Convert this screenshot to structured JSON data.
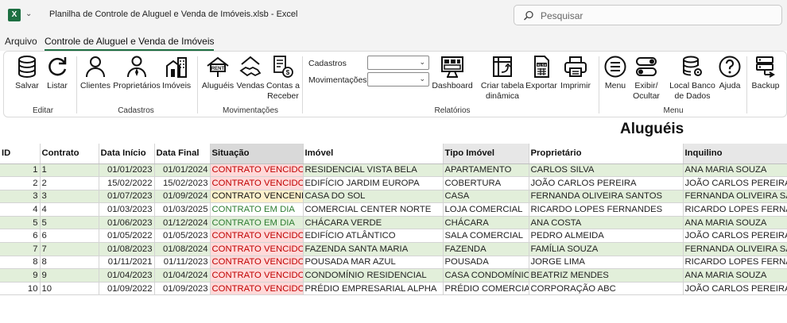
{
  "window": {
    "app_icon": "excel-icon",
    "title": "Planilha de Controle de Aluguel e Venda de Imóveis.xlsb  -  Excel",
    "search_placeholder": "Pesquisar"
  },
  "tabs": [
    "Arquivo",
    "Controle de Aluguel e Venda de Imóveis"
  ],
  "ribbon": {
    "groups": {
      "editar": "Editar",
      "cadastros": "Cadastros",
      "movimentacoes": "Movimentações",
      "relatorios": "Relatórios",
      "menu": "Menu"
    },
    "buttons": {
      "salvar": "Salvar",
      "listar": "Listar",
      "clientes": "Clientes",
      "proprietarios": "Proprietários",
      "imoveis": "Imóveis",
      "alugueis": "Aluguéis",
      "vendas": "Vendas",
      "contas_a_receber_1": "Contas a",
      "contas_a_receber_2": "Receber",
      "dashboard": "Dashboard",
      "criar_tabela_1": "Criar tabela",
      "criar_tabela_2": "dinâmica",
      "exportar": "Exportar",
      "imprimir": "Imprimir",
      "menu": "Menu",
      "exibir_1": "Exibir/",
      "exibir_2": "Ocultar",
      "local_banco_1": "Local Banco",
      "local_banco_2": "de Dados",
      "ajuda": "Ajuda",
      "backup": "Backup"
    },
    "fields": {
      "cadastros_label": "Cadastros",
      "movimentacoes_label": "Movimentações",
      "cadastros_value": "",
      "movimentacoes_value": ""
    }
  },
  "sheet": {
    "title": "Aluguéis",
    "columns": [
      "ID",
      "Contrato",
      "Data Início",
      "Data Final",
      "Situação",
      "Imóvel",
      "Tipo Imóvel",
      "Proprietário",
      "Inquilino"
    ],
    "rows": [
      {
        "id": "1",
        "contrato": "1",
        "inicio": "01/01/2023",
        "final": "01/01/2024",
        "situacao": "CONTRATO VENCIDO",
        "status": "venc",
        "imovel": "RESIDENCIAL VISTA BELA",
        "tipo": "APARTAMENTO",
        "proprietario": "CARLOS SILVA",
        "inquilino": "ANA MARIA SOUZA"
      },
      {
        "id": "2",
        "contrato": "2",
        "inicio": "15/02/2022",
        "final": "15/02/2023",
        "situacao": "CONTRATO VENCIDO",
        "status": "venc",
        "imovel": "EDIFÍCIO JARDIM EUROPA",
        "tipo": "COBERTURA",
        "proprietario": "JOÃO CARLOS PEREIRA",
        "inquilino": "JOÃO CARLOS PEREIRA"
      },
      {
        "id": "3",
        "contrato": "3",
        "inicio": "01/07/2023",
        "final": "01/09/2024",
        "situacao": "CONTRATO VENCENDO",
        "status": "vcd",
        "imovel": "CASA DO SOL",
        "tipo": "CASA",
        "proprietario": "FERNANDA OLIVEIRA SANTOS",
        "inquilino": "FERNANDA OLIVEIRA SANTOS"
      },
      {
        "id": "4",
        "contrato": "4",
        "inicio": "01/03/2023",
        "final": "01/03/2025",
        "situacao": "CONTRATO EM DIA",
        "status": "dia",
        "imovel": "COMERCIAL CENTER NORTE",
        "tipo": "LOJA COMERCIAL",
        "proprietario": "RICARDO LOPES FERNANDES",
        "inquilino": "RICARDO LOPES FERNANDES"
      },
      {
        "id": "5",
        "contrato": "5",
        "inicio": "01/06/2023",
        "final": "01/12/2024",
        "situacao": "CONTRATO EM DIA",
        "status": "dia",
        "imovel": "CHÁCARA VERDE",
        "tipo": "CHÁCARA",
        "proprietario": "ANA COSTA",
        "inquilino": "ANA MARIA SOUZA"
      },
      {
        "id": "6",
        "contrato": "6",
        "inicio": "01/05/2022",
        "final": "01/05/2023",
        "situacao": "CONTRATO VENCIDO",
        "status": "venc",
        "imovel": "EDIFÍCIO ATLÂNTICO",
        "tipo": "SALA COMERCIAL",
        "proprietario": "PEDRO ALMEIDA",
        "inquilino": "JOÃO CARLOS PEREIRA"
      },
      {
        "id": "7",
        "contrato": "7",
        "inicio": "01/08/2023",
        "final": "01/08/2024",
        "situacao": "CONTRATO VENCIDO",
        "status": "venc",
        "imovel": "FAZENDA SANTA MARIA",
        "tipo": "FAZENDA",
        "proprietario": "FAMÍLIA SOUZA",
        "inquilino": "FERNANDA OLIVEIRA SANTOS"
      },
      {
        "id": "8",
        "contrato": "8",
        "inicio": "01/11/2021",
        "final": "01/11/2023",
        "situacao": "CONTRATO VENCIDO",
        "status": "venc",
        "imovel": "POUSADA MAR AZUL",
        "tipo": "POUSADA",
        "proprietario": "JORGE LIMA",
        "inquilino": "RICARDO LOPES FERNANDES"
      },
      {
        "id": "9",
        "contrato": "9",
        "inicio": "01/04/2023",
        "final": "01/04/2024",
        "situacao": "CONTRATO VENCIDO",
        "status": "venc",
        "imovel": "CONDOMÍNIO RESIDENCIAL",
        "tipo": "CASA CONDOMÍNIO",
        "proprietario": "BEATRIZ MENDES",
        "inquilino": "ANA MARIA SOUZA"
      },
      {
        "id": "10",
        "contrato": "10",
        "inicio": "01/09/2022",
        "final": "01/09/2023",
        "situacao": "CONTRATO VENCIDO",
        "status": "venc",
        "imovel": "PRÉDIO EMPRESARIAL ALPHA",
        "tipo": "PRÉDIO COMERCIAL",
        "proprietario": "CORPORAÇÃO ABC",
        "inquilino": "JOÃO CARLOS PEREIRA"
      }
    ]
  },
  "colors": {
    "excel_green": "#1d6f42",
    "row_band": "#e2efda",
    "vencido_bg": "#ffd9d9",
    "vencido_text": "#c00000",
    "vencendo_bg": "#fff2cc",
    "em_dia_text": "#2e7d32"
  }
}
